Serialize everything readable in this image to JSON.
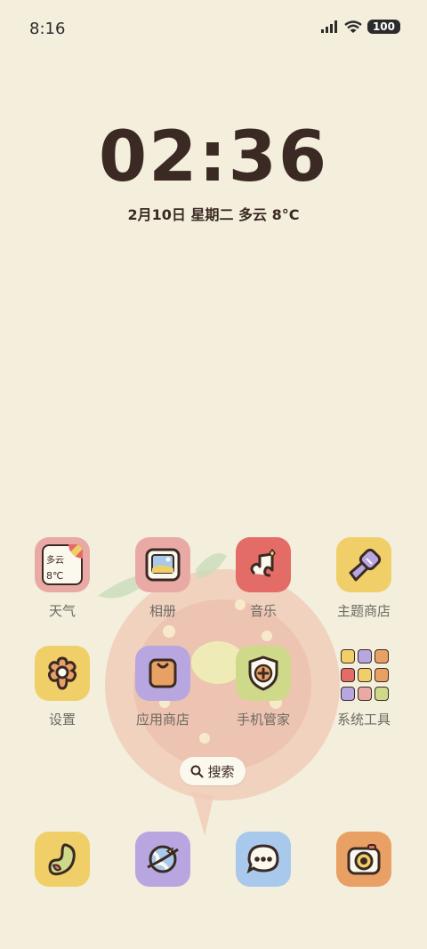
{
  "status_bar": {
    "time": "8:16",
    "battery": "100"
  },
  "clock": {
    "time": "02:36",
    "date_line": "2月10日  星期二  多云  8°C"
  },
  "apps": [
    {
      "label": "天气",
      "icon": "weather-icon",
      "bg": "#e9aaa6",
      "weather_text": "多云",
      "temp": "8℃"
    },
    {
      "label": "相册",
      "icon": "gallery-icon",
      "bg": "#e9aaa6"
    },
    {
      "label": "音乐",
      "icon": "music-icon",
      "bg": "#e46c67"
    },
    {
      "label": "主题商店",
      "icon": "theme-store-icon",
      "bg": "#f0cf68"
    },
    {
      "label": "设置",
      "icon": "settings-icon",
      "bg": "#f0cf68"
    },
    {
      "label": "应用商店",
      "icon": "app-store-icon",
      "bg": "#b8a6e0"
    },
    {
      "label": "手机管家",
      "icon": "security-icon",
      "bg": "#cfd98a"
    },
    {
      "label": "系统工具",
      "icon": "system-tools-folder-icon",
      "bg": "transparent"
    }
  ],
  "search": {
    "label": "搜索"
  },
  "dock": [
    {
      "icon": "phone-icon",
      "bg": "#f0cf68"
    },
    {
      "icon": "browser-icon",
      "bg": "#b8a6e0"
    },
    {
      "icon": "messages-icon",
      "bg": "#a9c9ec"
    },
    {
      "icon": "camera-icon",
      "bg": "#e9a064"
    }
  ]
}
